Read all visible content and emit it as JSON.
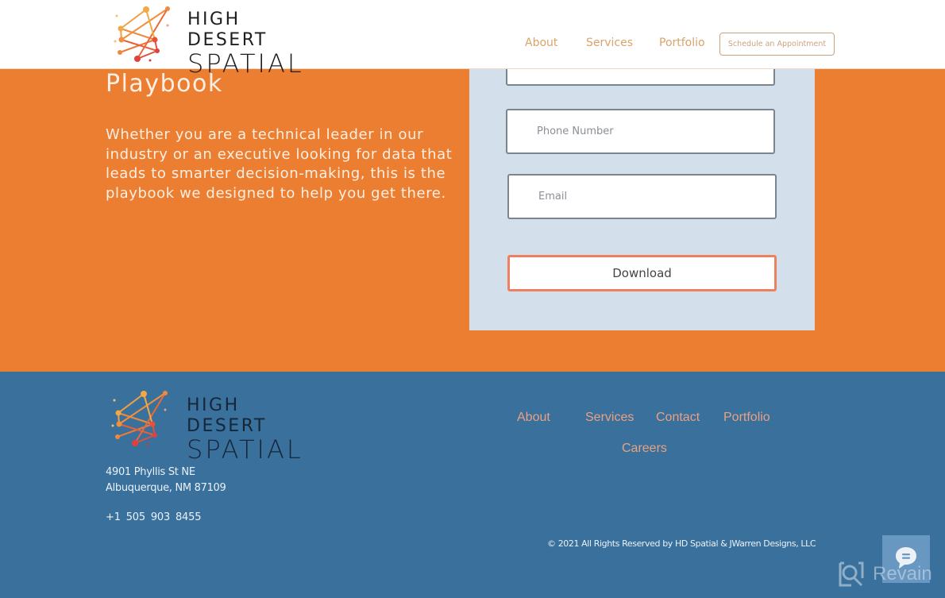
{
  "header": {
    "logo": {
      "line1": "HIGH DESERT",
      "line2": "SPATIAL"
    },
    "nav": [
      {
        "label": "About"
      },
      {
        "label": "Services"
      },
      {
        "label": "Portfolio"
      }
    ],
    "cta_label": "Schedule an Appointment"
  },
  "hero": {
    "title": "Playbook",
    "description": "Whether you are a technical leader in our industry or an executive looking for data that leads to smarter decision-making, this is the playbook we designed to help you get there."
  },
  "form": {
    "top_field_placeholder": "",
    "phone_placeholder": "Phone Number",
    "email_placeholder": "Email",
    "submit_label": "Download"
  },
  "footer": {
    "logo": {
      "line1": "HIGH DESERT",
      "line2": "SPATIAL"
    },
    "address_line1": "4901 Phyllis St NE",
    "address_line2": "Albuquerque, NM 87109",
    "phone": "+1 505  903  8455",
    "nav": [
      {
        "label": "About"
      },
      {
        "label": "Services"
      },
      {
        "label": "Contact"
      },
      {
        "label": "Portfolio"
      },
      {
        "label": "Careers"
      }
    ],
    "copyright": "© 2021 All Rights Reserved by HD Spatial & JWarren Designs, LLC"
  },
  "widgets": {
    "chat_icon": "chat-bubble-icon",
    "watermark": "Revain"
  },
  "colors": {
    "brand_orange": "#EC7E31",
    "footer_blue": "#3A709C",
    "form_panel": "#D3DFEA",
    "nav_text": "#D9A36A",
    "footer_link": "#E8A183",
    "button_border": "#EE8060"
  }
}
